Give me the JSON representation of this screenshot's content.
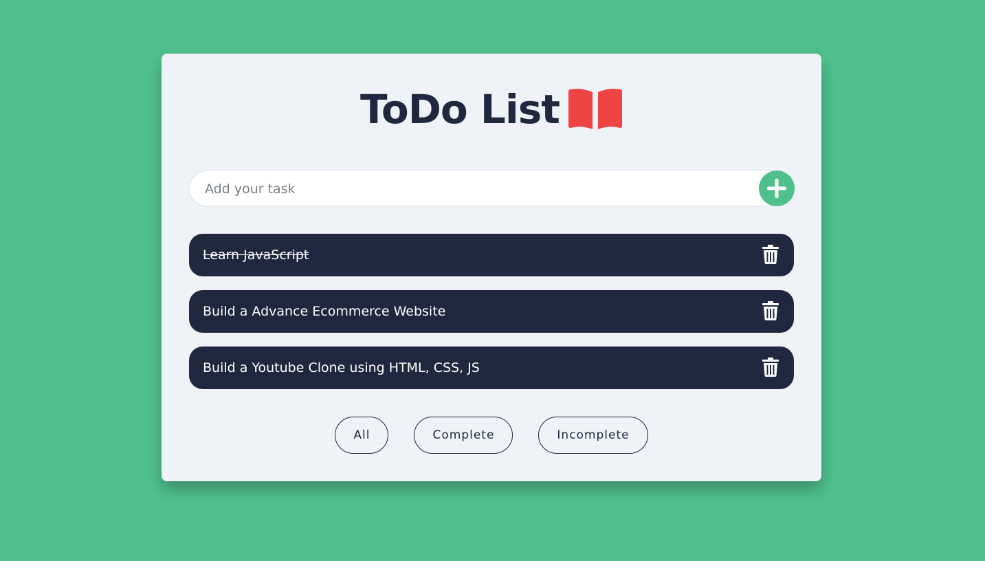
{
  "app": {
    "title": "ToDo List",
    "title_icon": "open-book-icon",
    "icon_color": "#ef4444"
  },
  "input": {
    "placeholder": "Add your task",
    "value": "",
    "add_icon": "plus-icon"
  },
  "tasks": [
    {
      "text": "Learn JavaScript",
      "completed": true,
      "delete_icon": "trash-icon"
    },
    {
      "text": "Build a Advance Ecommerce Website",
      "completed": false,
      "delete_icon": "trash-icon"
    },
    {
      "text": "Build a Youtube Clone using HTML, CSS, JS",
      "completed": false,
      "delete_icon": "trash-icon"
    }
  ],
  "filters": [
    "All",
    "Complete",
    "Incomplete"
  ],
  "colors": {
    "background": "#4fc08c",
    "card": "#eff3f8",
    "task_bg": "#1f283e",
    "accent": "#4fc08c"
  }
}
